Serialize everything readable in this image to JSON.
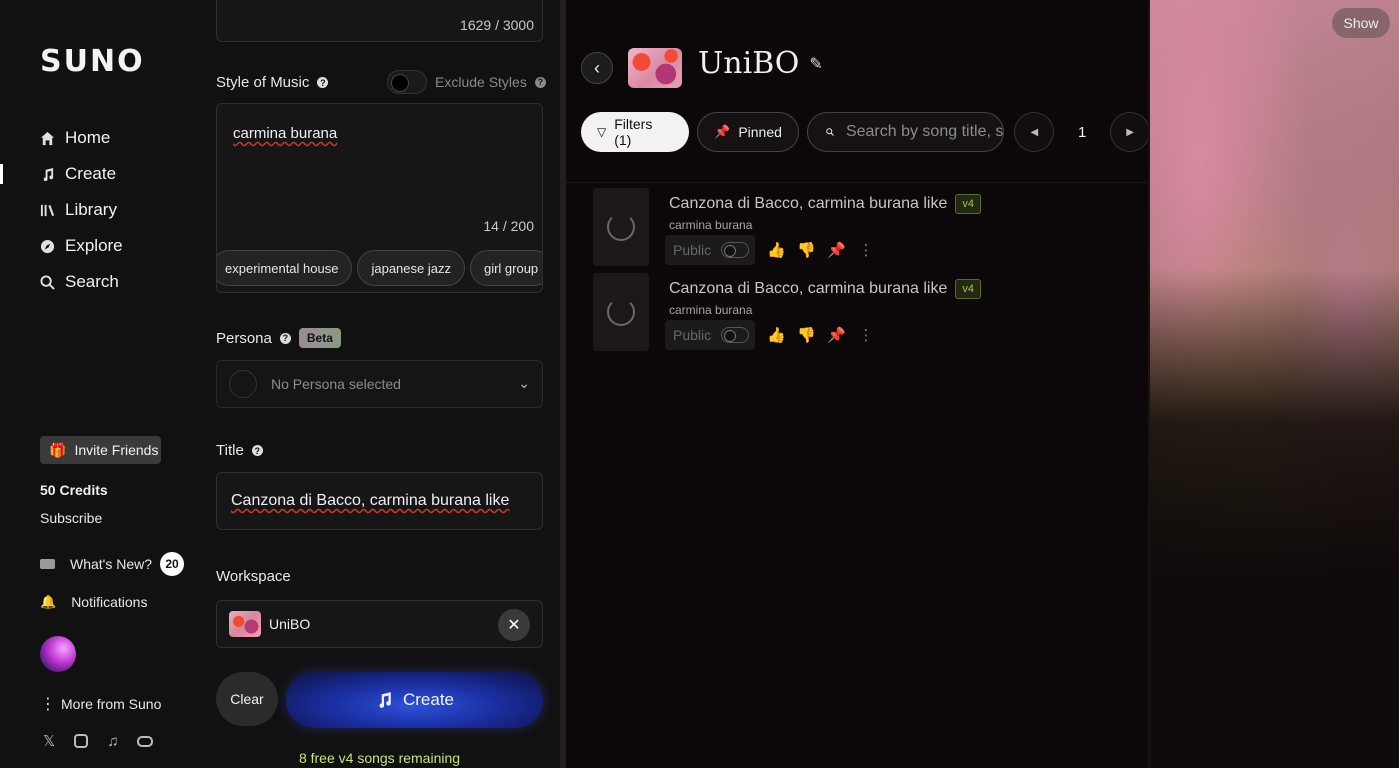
{
  "brand": {
    "logo": "SUNO"
  },
  "nav": {
    "items": [
      {
        "label": "Home",
        "icon": "home-icon"
      },
      {
        "label": "Create",
        "icon": "music-note-icon",
        "active": true
      },
      {
        "label": "Library",
        "icon": "library-icon"
      },
      {
        "label": "Explore",
        "icon": "compass-icon"
      },
      {
        "label": "Search",
        "icon": "search-icon"
      }
    ],
    "invite": "Invite Friends",
    "credits": "50 Credits",
    "subscribe": "Subscribe",
    "whats_new": "What's New?",
    "whats_new_count": "20",
    "notifications": "Notifications",
    "more": "More from Suno"
  },
  "form": {
    "lyrics_counter": "1629 / 3000",
    "style_label": "Style of Music",
    "exclude_label": "Exclude Styles",
    "style_value": "carmina burana",
    "style_counter": "14 / 200",
    "chips": [
      "experimental house",
      "japanese jazz",
      "girl group"
    ],
    "persona_label": "Persona",
    "beta": "Beta",
    "persona_placeholder": "No Persona selected",
    "title_label": "Title",
    "title_value": "Canzona di Bacco, carmina burana like",
    "workspace_label": "Workspace",
    "workspace_value": "UniBO",
    "clear": "Clear",
    "create": "Create",
    "remaining": "8 free v4 songs remaining"
  },
  "panel": {
    "title": "UniBO",
    "filters": "Filters (1)",
    "pinned": "Pinned",
    "search_placeholder": "Search by song title, s",
    "page": "1",
    "songs": [
      {
        "title": "Canzona di Bacco, carmina burana like",
        "version": "v4",
        "style": "carmina burana",
        "visibility": "Public"
      },
      {
        "title": "Canzona di Bacco, carmina burana like",
        "version": "v4",
        "style": "carmina burana",
        "visibility": "Public"
      }
    ]
  },
  "art": {
    "show": "Show"
  },
  "colors": {
    "accent_green": "#c6e27a",
    "create_blue": "#2d52d8",
    "version_green": "#a6c34a"
  }
}
